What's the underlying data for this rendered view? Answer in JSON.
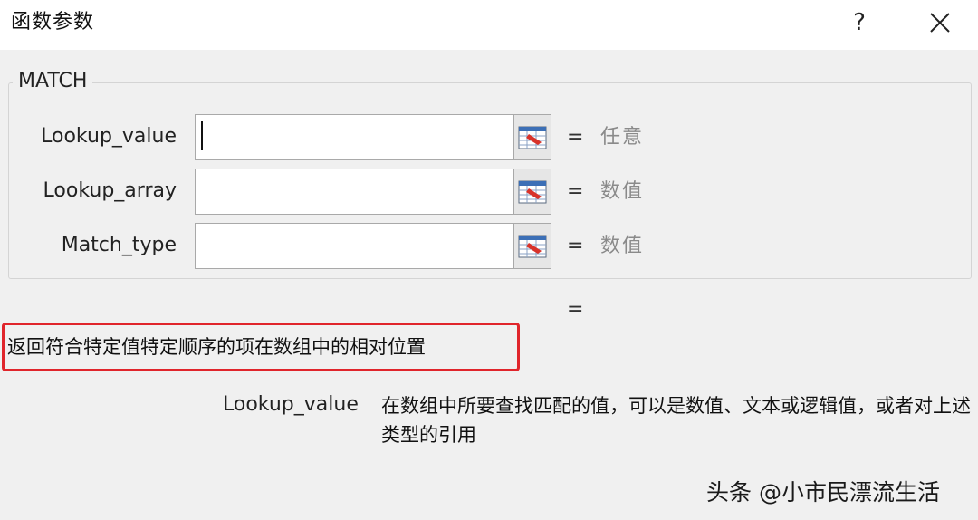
{
  "dialog": {
    "title": "函数参数",
    "help_label": "?",
    "close_label": "✕"
  },
  "function_group": {
    "name": "MATCH",
    "arguments": [
      {
        "label": "Lookup_value",
        "value": "",
        "type_hint": "任意"
      },
      {
        "label": "Lookup_array",
        "value": "",
        "type_hint": "数值"
      },
      {
        "label": "Match_type",
        "value": "",
        "type_hint": "数值"
      }
    ],
    "equals_sign": "="
  },
  "result": {
    "equals_sign": "=",
    "value": ""
  },
  "description": "返回符合特定值特定顺序的项在数组中的相对位置",
  "argument_help": {
    "name": "Lookup_value",
    "text": "在数组中所要查找匹配的值，可以是数值、文本或逻辑值，或者对上述类型的引用"
  },
  "watermark": "头条 @小市民漂流生活",
  "colors": {
    "highlight_border": "#e0252b",
    "ref_icon_red": "#d8322a",
    "ref_icon_blue": "#3c6fb6"
  },
  "icons": {
    "ref_button": "range-select-icon"
  }
}
